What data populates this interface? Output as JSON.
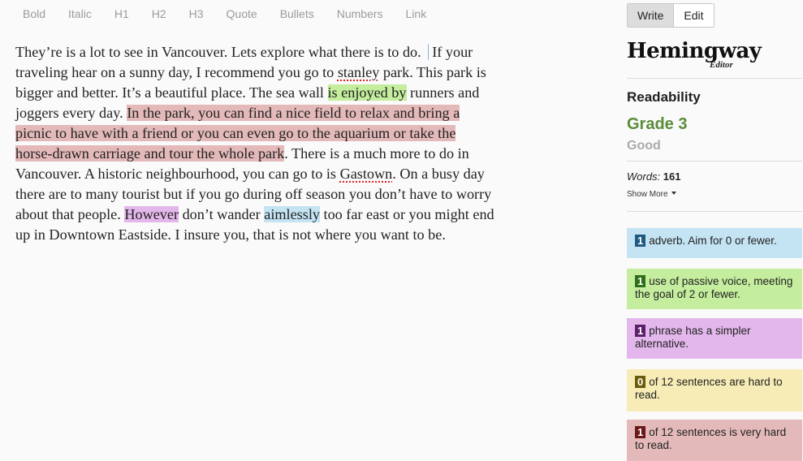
{
  "toolbar": {
    "items": [
      "Bold",
      "Italic",
      "H1",
      "H2",
      "H3",
      "Quote",
      "Bullets",
      "Numbers",
      "Link"
    ]
  },
  "editor": {
    "s1": "They’re is a lot to see in Vancouver. Lets explore what there is to do.",
    "s2a": "If your traveling hear on a sunny day, I recommend you go to",
    "s2_spell": "stanley",
    "s2b": "park. This park is bigger and better. It’s a beautiful place.",
    "s3a": "The sea wall",
    "s3_passive": "is enjoyed by",
    "s3b": "runners and joggers every day.",
    "s4_vhard": "In the park, you can find a nice field to relax and bring a picnic to have with a friend or you can even go to the aquarium or take the horse-drawn carriage and tour the whole park",
    "s4_end": ".",
    "s5": "There is a much more to do in Vancouver. A historic neighbourhood, you can go to is",
    "s5_spell": "Gastown",
    "s5_end": ".",
    "s6": "On a busy day there are to many tourist but if you go during off season you don’t have to worry about that people.",
    "s7_simpler": "However",
    "s7a": "don’t wander",
    "s7_adverb": "aimlessly",
    "s7b": "too far east or you might end up in Downtown Eastside. I insure you, that is not where you want to be."
  },
  "sidebar": {
    "mode": {
      "write": "Write",
      "edit": "Edit",
      "active": "Write"
    },
    "logo": {
      "main": "Hemingway",
      "sub": "Editor"
    },
    "readability_label": "Readability",
    "grade": "Grade 3",
    "grade_desc": "Good",
    "words_label": "Words:",
    "words_value": "161",
    "show_more": "Show More",
    "cards": {
      "adverb": {
        "count": "1",
        "text": "adverb. Aim for 0 or fewer."
      },
      "passive": {
        "count": "1",
        "text": "use of passive voice, meeting the goal of 2 or fewer."
      },
      "simpler": {
        "count": "1",
        "text": "phrase has a simpler alternative."
      },
      "hard": {
        "count": "0",
        "text": "of 12 sentences are hard to read."
      },
      "vhard": {
        "count": "1",
        "text": "of 12 sentences is very hard to read."
      }
    }
  },
  "colors": {
    "adverb": "#c4e3f3",
    "passive": "#c4ed9d",
    "simpler": "#e3b7eb",
    "hard": "#f7ecb5",
    "very_hard": "#e4b9b9",
    "grade_green": "#5a8c3a"
  }
}
